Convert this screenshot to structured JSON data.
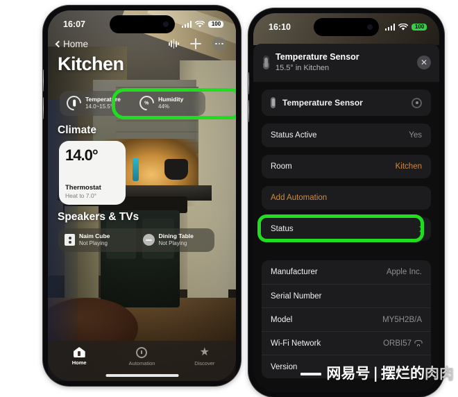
{
  "left_phone": {
    "status_bar": {
      "time": "16:07",
      "battery": "100",
      "battery_color": "#f5f5f5",
      "wifi_icon": "wifi-icon",
      "signal_icon": "cellular-signal-icon"
    },
    "nav": {
      "back_label": "Home",
      "back_icon": "chevron-left-icon",
      "intercom_icon": "intercom-waveform-icon",
      "add_icon": "plus-icon",
      "more_icon": "ellipsis-icon"
    },
    "room_title": "Kitchen",
    "sensors": [
      {
        "name": "Temperature",
        "value": "14.0~15.5°",
        "icon": "thermometer-gauge-icon"
      },
      {
        "name": "Humidity",
        "value": "44%",
        "icon": "humidity-gauge-icon",
        "gauge_text": "%"
      }
    ],
    "sections": [
      {
        "heading": "Climate"
      },
      {
        "heading": "Speakers & TVs"
      }
    ],
    "climate_tile": {
      "temperature": "14.0°",
      "name": "Thermostat",
      "status": "Heat to 7.0°"
    },
    "speakers": [
      {
        "name": "Naim Cube",
        "status": "Not Playing",
        "icon": "speaker-box-icon"
      },
      {
        "name": "Dining Table",
        "status": "Not Playing",
        "icon": "speaker-round-icon"
      }
    ],
    "tabs": [
      {
        "label": "Home",
        "icon": "home-icon",
        "active": true
      },
      {
        "label": "Automation",
        "icon": "clock-icon",
        "active": false
      },
      {
        "label": "Discover",
        "icon": "star-icon",
        "active": false
      }
    ]
  },
  "right_phone": {
    "status_bar": {
      "time": "16:10",
      "battery": "100",
      "battery_color": "#35d04a",
      "wifi_icon": "wifi-icon",
      "signal_icon": "cellular-signal-icon"
    },
    "sheet_header": {
      "title": "Temperature Sensor",
      "subtitle": "15.5° in Kitchen",
      "icon": "thermometer-icon",
      "close_icon": "close-icon",
      "close_label": "✕"
    },
    "device_row": {
      "label": "Temperature Sensor",
      "icon": "thermometer-icon",
      "trailing_icon": "status-ring-icon"
    },
    "rows": [
      {
        "label": "Status Active",
        "value": "Yes"
      },
      {
        "label": "Room",
        "value": "Kitchen",
        "value_color": "#d08a3e"
      }
    ],
    "action_row": {
      "label": "Add Automation",
      "color": "#d08a3e",
      "highlighted": true
    },
    "status_row": {
      "label": "Status",
      "trailing_icon": "chevron-right-icon"
    },
    "info_rows": [
      {
        "label": "Manufacturer",
        "value": "Apple Inc."
      },
      {
        "label": "Serial Number",
        "value": ""
      },
      {
        "label": "Model",
        "value": "MY5H2B/A"
      },
      {
        "label": "Wi-Fi Network",
        "value": "ORBI57",
        "trailing_icon": "wifi-icon"
      },
      {
        "label": "Version",
        "value": ""
      }
    ]
  },
  "highlight_color": "#21dd21",
  "watermark": {
    "prefix": "网易号",
    "separator": "|",
    "suffix": "摆烂的",
    "suffix_fade": "肉肉"
  }
}
